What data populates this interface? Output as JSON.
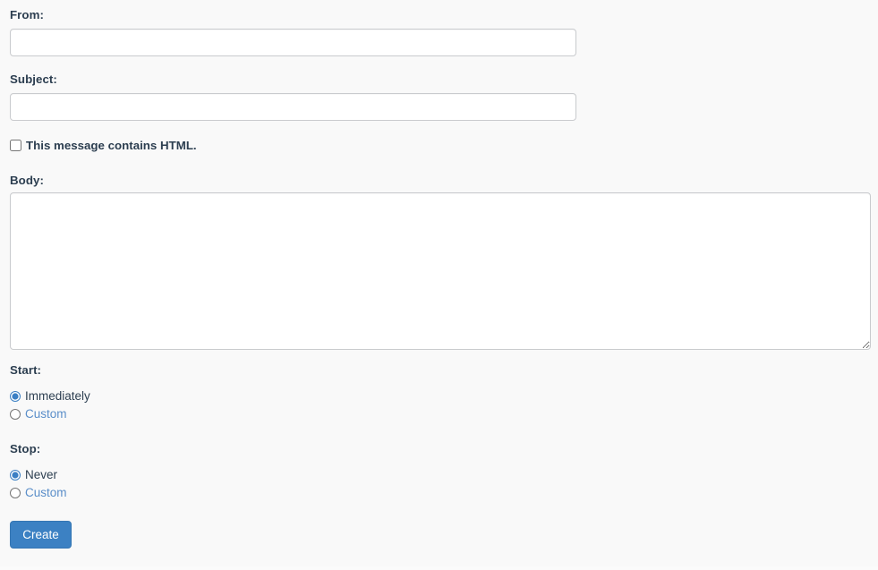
{
  "form": {
    "fields": {
      "from": {
        "label": "From:",
        "value": "",
        "placeholder": ""
      },
      "subject": {
        "label": "Subject:",
        "value": "",
        "placeholder": ""
      },
      "html_checkbox": {
        "label": "This message contains HTML.",
        "checked": false
      },
      "body": {
        "label": "Body:",
        "value": "",
        "placeholder": ""
      }
    },
    "start": {
      "label": "Start:",
      "options": [
        {
          "label": "Immediately",
          "value": "immediately",
          "selected": true,
          "style": "plain"
        },
        {
          "label": "Custom",
          "value": "custom",
          "selected": false,
          "style": "link"
        }
      ]
    },
    "stop": {
      "label": "Stop:",
      "options": [
        {
          "label": "Never",
          "value": "never",
          "selected": true,
          "style": "plain"
        },
        {
          "label": "Custom",
          "value": "custom",
          "selected": false,
          "style": "link"
        }
      ]
    },
    "submit": {
      "label": "Create"
    }
  },
  "colors": {
    "page_background": "#f9f9f9",
    "label_text": "#2c3e50",
    "input_background": "#ffffff",
    "input_border": "#c9cbce",
    "link_text": "#5a8ec9",
    "button_background": "#3c81c3",
    "button_border": "#3576b3",
    "button_text": "#ffffff",
    "radio_accent": "#3b7fc4"
  }
}
